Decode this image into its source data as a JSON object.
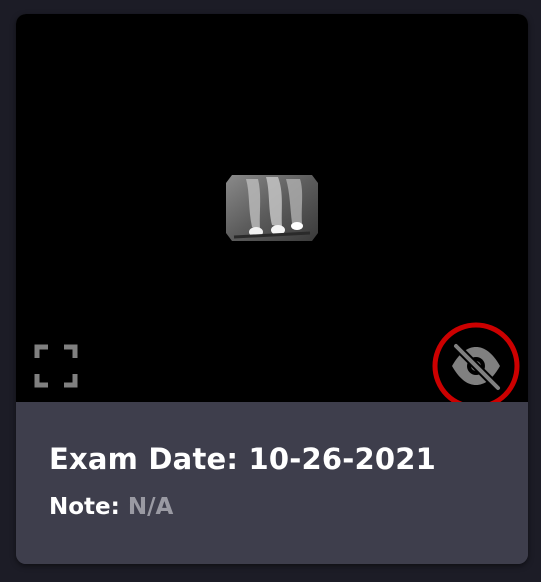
{
  "card": {
    "exam_date_label": "Exam Date:",
    "exam_date_value": "10-26-2021",
    "note_label": "Note:",
    "note_value": "N/A"
  },
  "icons": {
    "fullscreen": "fullscreen-icon",
    "visibility": "eye-slash-icon"
  },
  "colors": {
    "viewer_background": "#000000",
    "info_background": "#3e3e4c",
    "highlight_ring": "#cc0000",
    "icon_gray": "#808080",
    "note_value": "#9a9aa3"
  }
}
